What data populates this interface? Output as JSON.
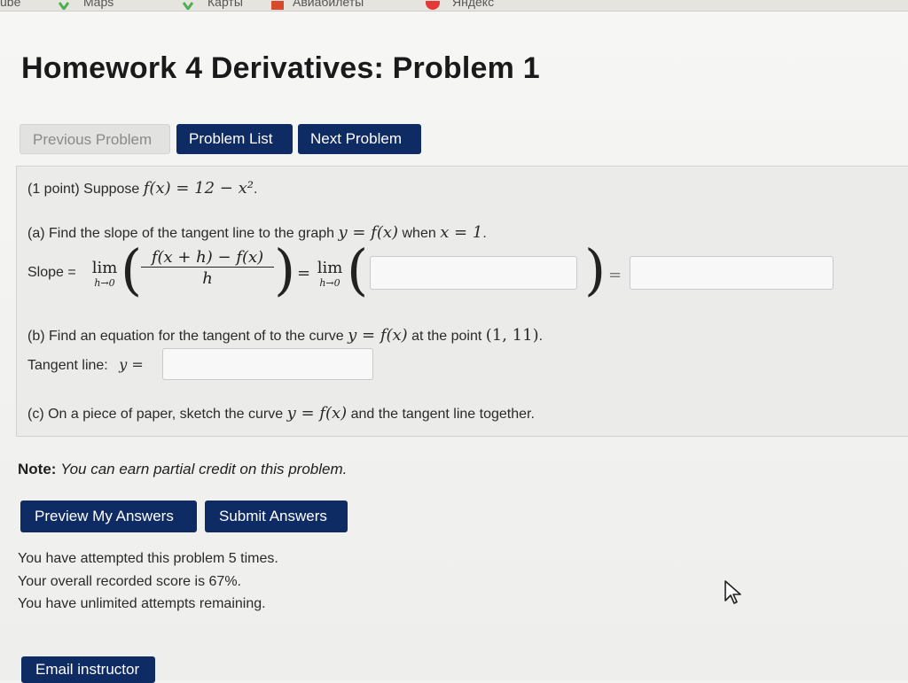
{
  "bookmarks": [
    {
      "label": "ube",
      "icon": "video-icon",
      "color": "#cc3333"
    },
    {
      "label": "Maps",
      "icon": "maps-pin-icon",
      "color": "#4caf50"
    },
    {
      "label": "Карты",
      "icon": "maps-pin-icon",
      "color": "#4caf50"
    },
    {
      "label": "Авиабилеты",
      "icon": "plane-icon",
      "color": "#d94a2b"
    },
    {
      "label": "Яндекс",
      "icon": "yandex-icon",
      "color": "#e53935"
    }
  ],
  "page_title": "Homework 4 Derivatives: Problem 1",
  "nav": {
    "previous": "Previous Problem",
    "list": "Problem List",
    "next": "Next Problem"
  },
  "problem": {
    "intro_prefix": "(1 point) Suppose",
    "intro_math": "f(x) = 12 − x²",
    "part_a_text": "(a) Find the slope of the tangent line to the graph",
    "part_a_math_1": "y = f(x)",
    "part_a_when": "when",
    "part_a_math_2": "x = 1",
    "slope_label": "Slope =",
    "lim_top": "lim",
    "lim_bottom": "h→0",
    "numerator": "f(x + h) − f(x)",
    "denominator": "h",
    "equals": "=",
    "limit_answer_value": "",
    "slope_answer_value": "",
    "part_b_text": "(b) Find an equation for the tangent of to the curve",
    "part_b_math": "y = f(x)",
    "part_b_at": "at the point",
    "part_b_point": "(1, 11)",
    "tangent_label": "Tangent line:",
    "tangent_math": "y =",
    "tangent_answer_value": "",
    "part_c_text": "(c) On a piece of paper, sketch the curve",
    "part_c_math": "y = f(x)",
    "part_c_end": "and the tangent line together."
  },
  "note": {
    "label": "Note:",
    "text": "You can earn partial credit on this problem."
  },
  "actions": {
    "preview": "Preview My Answers",
    "submit": "Submit Answers"
  },
  "status": {
    "attempts": "You have attempted this problem 5 times.",
    "score": "Your overall recorded score is 67%.",
    "remaining": "You have unlimited attempts remaining."
  },
  "email": "Email instructor",
  "colors": {
    "button_bg": "#0f2b63",
    "button_text": "#ffffff",
    "disabled_text": "#8a8a8a"
  }
}
